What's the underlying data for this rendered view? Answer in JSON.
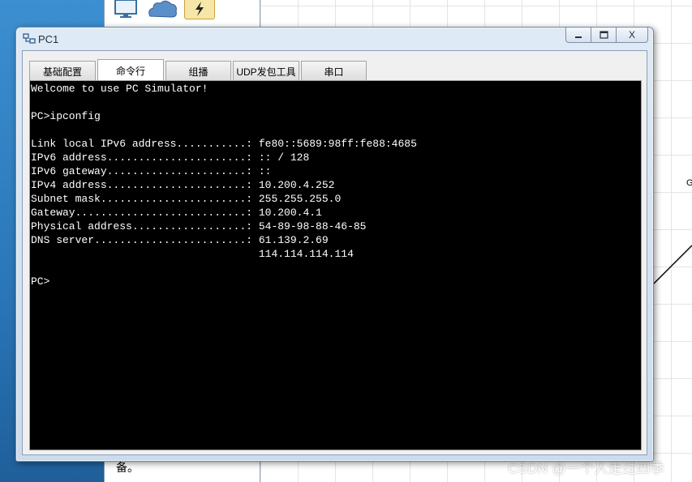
{
  "window": {
    "title": "PC1",
    "minimize_label": "—",
    "maximize_label": "☐",
    "close_label": "X"
  },
  "tabs": [
    {
      "label": "基础配置"
    },
    {
      "label": "命令行"
    },
    {
      "label": "组播"
    },
    {
      "label": "UDP发包工具"
    },
    {
      "label": "串口"
    }
  ],
  "active_tab": "命令行",
  "terminal": {
    "lines": [
      "Welcome to use PC Simulator!",
      "",
      "PC>ipconfig",
      "",
      "Link local IPv6 address...........: fe80::5689:98ff:fe88:4685",
      "IPv6 address......................: :: / 128",
      "IPv6 gateway......................: ::",
      "IPv4 address......................: 10.200.4.252",
      "Subnet mask.......................: 255.255.255.0",
      "Gateway...........................: 10.200.4.1",
      "Physical address..................: 54-89-98-88-46-85",
      "DNS server........................: 61.139.2.69",
      "                                    114.114.114.114",
      "",
      "PC>"
    ]
  },
  "background": {
    "note_text": "备。",
    "edge_label": "G",
    "watermark": "CSDN @一个人走过四季"
  },
  "colors": {
    "terminal_bg": "#000000",
    "terminal_fg": "#ffffff",
    "window_frame": "#cbdcee",
    "desktop": "#2f7fc0"
  },
  "icons": [
    "pc-monitor-icon",
    "cloud-icon",
    "power-icon",
    "pc1-network-icon"
  ]
}
